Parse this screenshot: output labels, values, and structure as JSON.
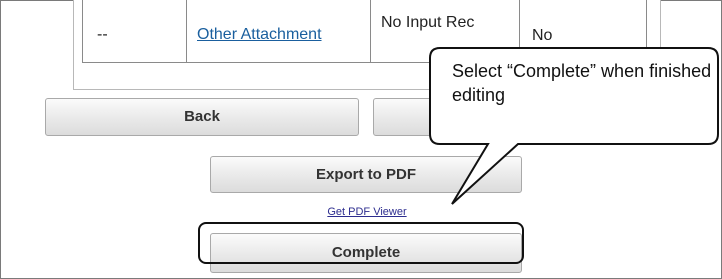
{
  "table": {
    "row": {
      "col1": "--",
      "col2": "Other Attachment",
      "col3": "No Input Rec",
      "col4": "No"
    }
  },
  "buttons": {
    "back": "Back",
    "second": "",
    "export": "Export to PDF",
    "pdf_viewer": "Get PDF Viewer",
    "complete": "Complete"
  },
  "callout": {
    "text": "Select “Complete” when finished editing"
  }
}
